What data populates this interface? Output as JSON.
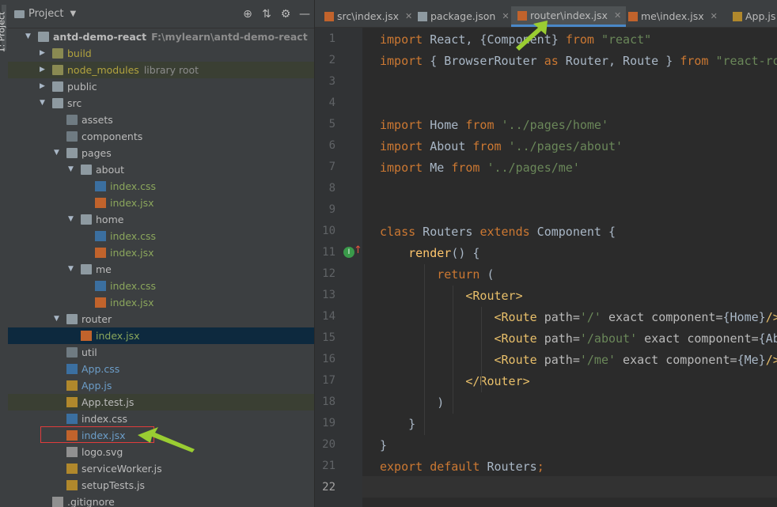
{
  "sidebar": {
    "tool_window_label": "1: Project",
    "title": "Project",
    "toolbar_icons": [
      "target-icon",
      "collapse-icon",
      "gear-icon",
      "hide-icon"
    ]
  },
  "tree": [
    {
      "label": "antd-demo-react",
      "hint": "F:\\mylearn\\antd-demo-react",
      "type": "folder",
      "depth": 0,
      "expanded": true,
      "bold": true
    },
    {
      "label": "build",
      "type": "folder-olive",
      "depth": 1,
      "expanded": false,
      "color": "olive"
    },
    {
      "label": "node_modules",
      "hint": "library root",
      "type": "folder-olive",
      "depth": 1,
      "expanded": false,
      "color": "olive",
      "highlight": true
    },
    {
      "label": "public",
      "type": "folder",
      "depth": 1,
      "expanded": false
    },
    {
      "label": "src",
      "type": "folder",
      "depth": 1,
      "expanded": true
    },
    {
      "label": "assets",
      "type": "folder-dark",
      "depth": 2
    },
    {
      "label": "components",
      "type": "folder-dark",
      "depth": 2
    },
    {
      "label": "pages",
      "type": "folder",
      "depth": 2,
      "expanded": true
    },
    {
      "label": "about",
      "type": "folder",
      "depth": 3,
      "expanded": true
    },
    {
      "label": "index.css",
      "type": "css",
      "depth": 4,
      "color": "green"
    },
    {
      "label": "index.jsx",
      "type": "jsx",
      "depth": 4,
      "color": "green"
    },
    {
      "label": "home",
      "type": "folder",
      "depth": 3,
      "expanded": true
    },
    {
      "label": "index.css",
      "type": "css",
      "depth": 4,
      "color": "green"
    },
    {
      "label": "index.jsx",
      "type": "jsx",
      "depth": 4,
      "color": "green"
    },
    {
      "label": "me",
      "type": "folder",
      "depth": 3,
      "expanded": true
    },
    {
      "label": "index.css",
      "type": "css",
      "depth": 4,
      "color": "green"
    },
    {
      "label": "index.jsx",
      "type": "jsx",
      "depth": 4,
      "color": "green"
    },
    {
      "label": "router",
      "type": "folder",
      "depth": 2,
      "expanded": true
    },
    {
      "label": "index.jsx",
      "type": "jsx",
      "depth": 3,
      "color": "green",
      "selected": true
    },
    {
      "label": "util",
      "type": "folder-dark",
      "depth": 2
    },
    {
      "label": "App.css",
      "type": "css",
      "depth": 2,
      "color": "blue"
    },
    {
      "label": "App.js",
      "type": "js",
      "depth": 2,
      "color": "blue"
    },
    {
      "label": "App.test.js",
      "type": "js",
      "depth": 2,
      "color": "white",
      "highlight": true
    },
    {
      "label": "index.css",
      "type": "css",
      "depth": 2,
      "color": "white"
    },
    {
      "label": "index.jsx",
      "type": "jsx",
      "depth": 2,
      "color": "blue"
    },
    {
      "label": "logo.svg",
      "type": "gen",
      "depth": 2,
      "color": "white"
    },
    {
      "label": "serviceWorker.js",
      "type": "js",
      "depth": 2,
      "color": "white"
    },
    {
      "label": "setupTests.js",
      "type": "js",
      "depth": 2,
      "color": "white"
    },
    {
      "label": ".gitignore",
      "type": "gen",
      "depth": 1,
      "color": "white"
    }
  ],
  "tabs": [
    {
      "label": "src\\index.jsx",
      "icon": "jsx",
      "active": false
    },
    {
      "label": "package.json",
      "icon": "json",
      "active": false
    },
    {
      "label": "router\\index.jsx",
      "icon": "jsx",
      "active": true
    },
    {
      "label": "me\\index.jsx",
      "icon": "jsx",
      "active": false
    },
    {
      "label": "App.js",
      "icon": "js",
      "active": false
    }
  ],
  "editor": {
    "current_line": 22,
    "lines": [
      [
        [
          "kw",
          "import"
        ],
        [
          "plain",
          " React, {Component} "
        ],
        [
          "kw",
          "from"
        ],
        [
          "str",
          " \"react\""
        ]
      ],
      [
        [
          "kw",
          "import"
        ],
        [
          "plain",
          " { BrowserRouter "
        ],
        [
          "kw",
          "as"
        ],
        [
          "plain",
          " Router, Route } "
        ],
        [
          "kw",
          "from"
        ],
        [
          "str",
          " \"react-router-dom\""
        ]
      ],
      [],
      [],
      [
        [
          "kw",
          "import"
        ],
        [
          "plain",
          " Home "
        ],
        [
          "kw",
          "from"
        ],
        [
          "str",
          " '../pages/home'"
        ]
      ],
      [
        [
          "kw",
          "import"
        ],
        [
          "plain",
          " About "
        ],
        [
          "kw",
          "from"
        ],
        [
          "str",
          " '../pages/about'"
        ]
      ],
      [
        [
          "kw",
          "import"
        ],
        [
          "plain",
          " Me "
        ],
        [
          "kw",
          "from"
        ],
        [
          "str",
          " '../pages/me'"
        ]
      ],
      [],
      [],
      [
        [
          "kw",
          "class"
        ],
        [
          "plain",
          " Routers "
        ],
        [
          "kw",
          "extends"
        ],
        [
          "plain",
          " Component {"
        ]
      ],
      [
        [
          "plain",
          "    "
        ],
        [
          "fn",
          "render"
        ],
        [
          "plain",
          "() {"
        ]
      ],
      [
        [
          "plain",
          "        "
        ],
        [
          "kw",
          "return"
        ],
        [
          "plain",
          " ("
        ]
      ],
      [
        [
          "plain",
          "            "
        ],
        [
          "tag",
          "<Router>"
        ]
      ],
      [
        [
          "plain",
          "                "
        ],
        [
          "tag",
          "<Route "
        ],
        [
          "attr",
          "path="
        ],
        [
          "str",
          "'/'"
        ],
        [
          "attr",
          " exact component="
        ],
        [
          "plain",
          "{Home}"
        ],
        [
          "tag",
          "/>"
        ]
      ],
      [
        [
          "plain",
          "                "
        ],
        [
          "tag",
          "<Route "
        ],
        [
          "attr",
          "path="
        ],
        [
          "str",
          "'/about'"
        ],
        [
          "attr",
          " exact component="
        ],
        [
          "plain",
          "{About}"
        ],
        [
          "tag",
          "/>"
        ]
      ],
      [
        [
          "plain",
          "                "
        ],
        [
          "tag",
          "<Route "
        ],
        [
          "attr",
          "path="
        ],
        [
          "str",
          "'/me'"
        ],
        [
          "attr",
          " exact component="
        ],
        [
          "plain",
          "{Me}"
        ],
        [
          "tag",
          "/>"
        ]
      ],
      [
        [
          "plain",
          "            "
        ],
        [
          "tag",
          "</Router>"
        ]
      ],
      [
        [
          "plain",
          "        )"
        ]
      ],
      [
        [
          "plain",
          "    }"
        ]
      ],
      [
        [
          "plain",
          "}"
        ]
      ],
      [
        [
          "kw",
          "export default"
        ],
        [
          "plain",
          " Routers"
        ],
        [
          "kw",
          ";"
        ]
      ],
      []
    ]
  },
  "colors": {
    "accent": "#4a88c7",
    "selection": "#0d293e",
    "annotation_arrow": "#9acd32",
    "annotation_box": "#e03c3c"
  }
}
